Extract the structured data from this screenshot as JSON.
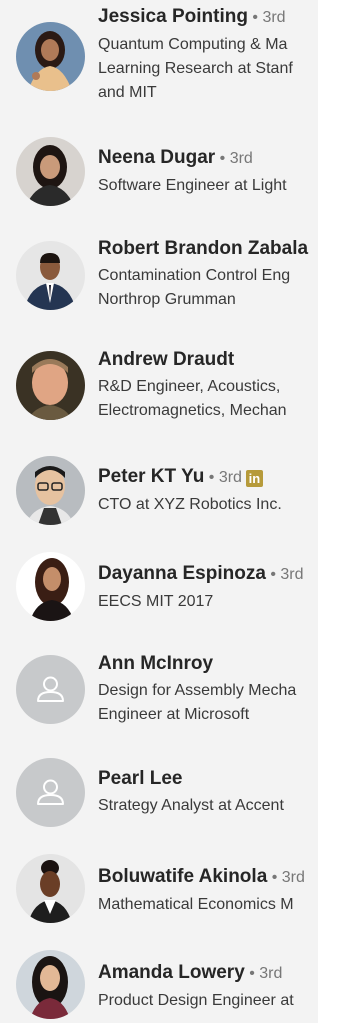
{
  "people": [
    {
      "name": "Jessica Pointing",
      "degree": "3rd",
      "headline_lines": [
        "Quantum Computing & Ma",
        "Learning Research at Stanf",
        "and MIT"
      ],
      "avatar": "photo",
      "badge": ""
    },
    {
      "name": "Neena Dugar",
      "degree": "3rd",
      "headline_lines": [
        "Software Engineer at Light"
      ],
      "avatar": "photo",
      "badge": ""
    },
    {
      "name": "Robert Brandon Zabala",
      "degree": "",
      "headline_lines": [
        "Contamination Control Eng",
        "Northrop Grumman"
      ],
      "avatar": "photo",
      "badge": ""
    },
    {
      "name": "Andrew Draudt",
      "degree": "",
      "headline_lines": [
        "R&D Engineer, Acoustics,",
        "Electromagnetics, Mechan"
      ],
      "avatar": "photo",
      "badge": ""
    },
    {
      "name": "Peter KT Yu",
      "degree": "3rd",
      "headline_lines": [
        "CTO at XYZ Robotics Inc."
      ],
      "avatar": "photo",
      "badge": "in"
    },
    {
      "name": "Dayanna Espinoza",
      "degree": "3rd",
      "headline_lines": [
        "EECS MIT 2017"
      ],
      "avatar": "photo",
      "badge": ""
    },
    {
      "name": "Ann McInroy",
      "degree": "",
      "headline_lines": [
        "Design for Assembly Mecha",
        "Engineer at Microsoft"
      ],
      "avatar": "person-placeholder-icon",
      "badge": ""
    },
    {
      "name": "Pearl Lee",
      "degree": "",
      "headline_lines": [
        "Strategy Analyst at Accent"
      ],
      "avatar": "person-placeholder-icon",
      "badge": ""
    },
    {
      "name": "Boluwatife Akinola",
      "degree": "3rd",
      "headline_lines": [
        "Mathematical Economics M"
      ],
      "avatar": "photo",
      "badge": ""
    },
    {
      "name": "Amanda Lowery",
      "degree": "3rd",
      "headline_lines": [
        "Product Design Engineer at"
      ],
      "avatar": "photo",
      "badge": ""
    }
  ],
  "colors": {
    "background": "#f3f3f3",
    "name": "#262626",
    "degree": "#777777",
    "headline": "#3a3a3a",
    "placeholder": "#c7c9cb",
    "badge": "#b69a3a"
  }
}
